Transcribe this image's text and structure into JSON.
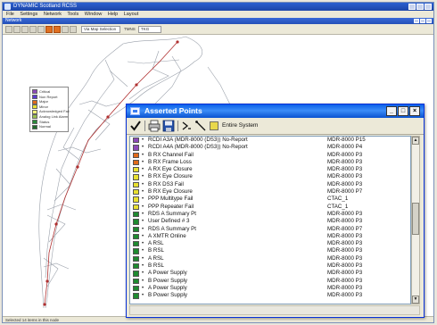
{
  "app": {
    "title": "DYNAMIC Scotland RCSS",
    "menu": [
      "File",
      "Settings",
      "Network",
      "Tools",
      "Window",
      "Help",
      "Layout"
    ],
    "child_title": "Network",
    "toolbar": {
      "field1": "Via Map Selection",
      "label1": "TMNS",
      "field2": "TKG"
    },
    "status": "Selected 14 items in this node"
  },
  "legend": {
    "items": [
      {
        "label": "Critical",
        "color": "#8c4ab8"
      },
      {
        "label": "Non Report",
        "color": "#5a3ad0"
      },
      {
        "label": "Major",
        "color": "#e06a1a"
      },
      {
        "label": "Minor",
        "color": "#e8e030"
      },
      {
        "label": "Acknowledged Fail",
        "color": "#f2f07a"
      },
      {
        "label": "Analog Link Alarm",
        "color": "#9ac050"
      },
      {
        "label": "Status",
        "color": "#2a8a3a"
      },
      {
        "label": "Normal",
        "color": "#1e6a2a"
      }
    ]
  },
  "dialog": {
    "title": "Asserted Points",
    "controls": {
      "minimize": "_",
      "maximize": "□",
      "close": "×"
    },
    "scope_label": "Entire System",
    "rows": [
      {
        "color": "#8c4ab8",
        "desc": "RCDI A3A (MDR-8000 (DS3)) No-Report",
        "src": "MDR-8000 P15"
      },
      {
        "color": "#8c4ab8",
        "desc": "RCDI A4A (MDR-8000 (DS3)) No-Report",
        "src": "MDR-8000 P4"
      },
      {
        "color": "#e06a1a",
        "desc": "B RX Channel Fail",
        "src": "MDR-8000 P3"
      },
      {
        "color": "#e06a1a",
        "desc": "B RX Frame Loss",
        "src": "MDR-8000 P3"
      },
      {
        "color": "#e8e030",
        "desc": "A RX Eye Closure",
        "src": "MDR-8000 P3"
      },
      {
        "color": "#e8e030",
        "desc": "B RX Eye Closure",
        "src": "MDR-8000 P3"
      },
      {
        "color": "#e8e030",
        "desc": "B RX DS3 Fail",
        "src": "MDR-8000 P3"
      },
      {
        "color": "#e8e030",
        "desc": "B RX Eye Closure",
        "src": "MDR-8000 P7"
      },
      {
        "color": "#e8e030",
        "desc": "PPP Multitype Fail",
        "src": "CTAC_1"
      },
      {
        "color": "#e8e030",
        "desc": "PPP Repeater Fail",
        "src": "CTAC_1"
      },
      {
        "color": "#1e8a30",
        "desc": "RDS A Summary Pt",
        "src": "MDR-8000 P3"
      },
      {
        "color": "#1e8a30",
        "desc": "User Defined # 3",
        "src": "MDR-8000 P3"
      },
      {
        "color": "#1e8a30",
        "desc": "RDS A Summary Pt",
        "src": "MDR-8000 P7"
      },
      {
        "color": "#1e8a30",
        "desc": "A XMTR Online",
        "src": "MDR-8000 P3"
      },
      {
        "color": "#1e8a30",
        "desc": "A RSL",
        "src": "MDR-8000 P3"
      },
      {
        "color": "#1e8a30",
        "desc": "B RSL",
        "src": "MDR-8000 P3"
      },
      {
        "color": "#1e8a30",
        "desc": "A RSL",
        "src": "MDR-8000 P3"
      },
      {
        "color": "#1e8a30",
        "desc": "B RSL",
        "src": "MDR-8000 P3"
      },
      {
        "color": "#1e8a30",
        "desc": "A Power Supply",
        "src": "MDR-8000 P3"
      },
      {
        "color": "#1e8a30",
        "desc": "B Power Supply",
        "src": "MDR-8000 P3"
      },
      {
        "color": "#1e8a30",
        "desc": "A Power Supply",
        "src": "MDR-8000 P3"
      },
      {
        "color": "#1e8a30",
        "desc": "B Power Supply",
        "src": "MDR-8000 P3"
      }
    ]
  }
}
